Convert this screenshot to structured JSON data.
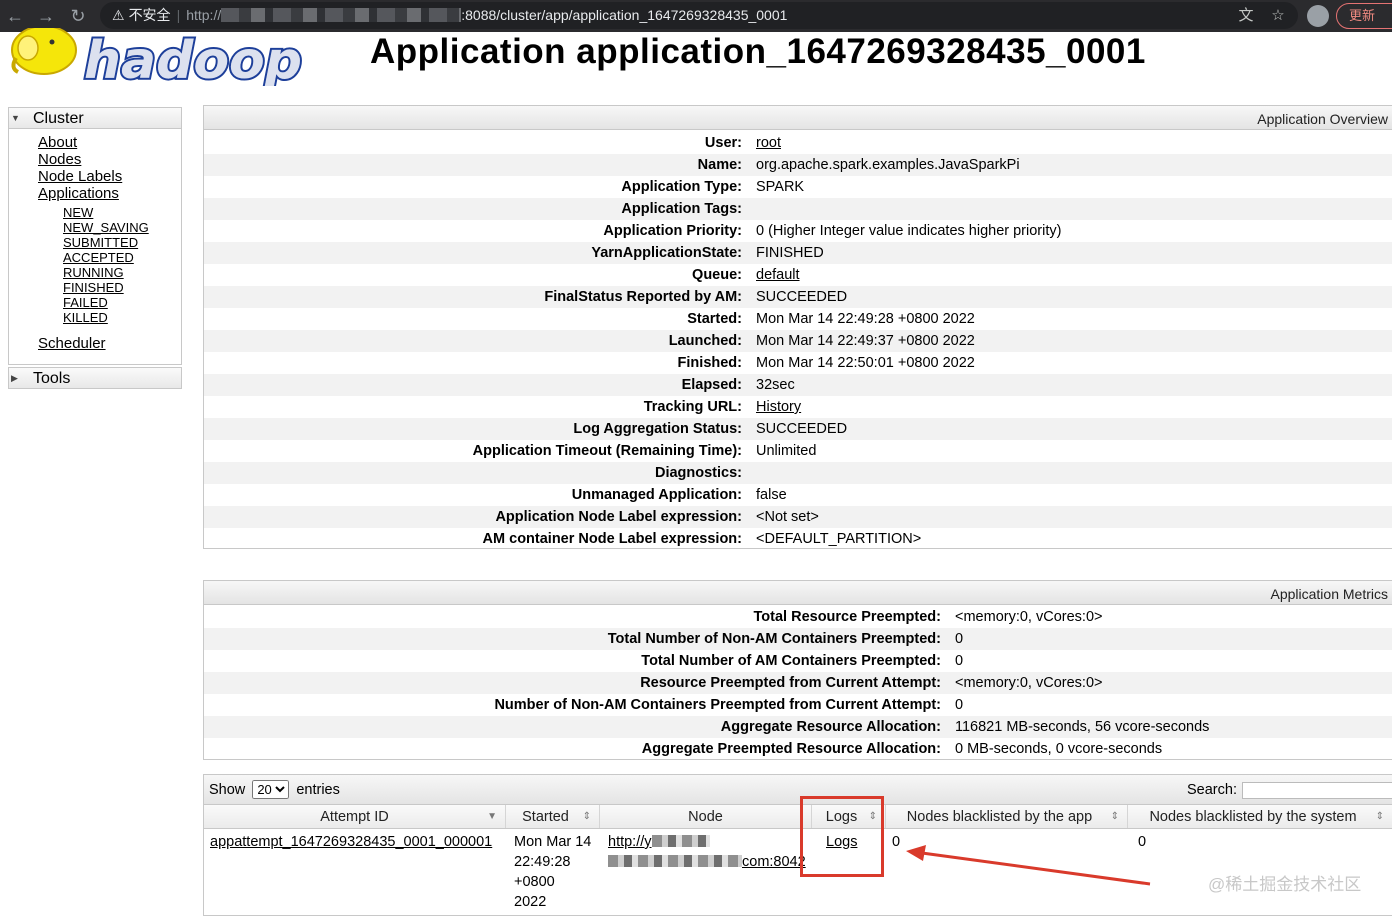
{
  "browser": {
    "security_label": "不安全",
    "url_scheme": "http://",
    "url_path": ":8088/cluster/app/application_1647269328435_0001",
    "update_label": "更新"
  },
  "page": {
    "title": "Application application_1647269328435_0001"
  },
  "sidebar": {
    "cluster_title": "Cluster",
    "links": [
      "About",
      "Nodes",
      "Node Labels",
      "Applications"
    ],
    "app_states": [
      "NEW",
      "NEW_SAVING",
      "SUBMITTED",
      "ACCEPTED",
      "RUNNING",
      "FINISHED",
      "FAILED",
      "KILLED"
    ],
    "scheduler": "Scheduler",
    "tools_title": "Tools"
  },
  "overview": {
    "title": "Application Overview",
    "rows": [
      {
        "k": "User:",
        "v": "root",
        "link": true
      },
      {
        "k": "Name:",
        "v": "org.apache.spark.examples.JavaSparkPi",
        "link": false
      },
      {
        "k": "Application Type:",
        "v": "SPARK",
        "link": false
      },
      {
        "k": "Application Tags:",
        "v": "",
        "link": false
      },
      {
        "k": "Application Priority:",
        "v": "0 (Higher Integer value indicates higher priority)",
        "link": false
      },
      {
        "k": "YarnApplicationState:",
        "v": "FINISHED",
        "link": false
      },
      {
        "k": "Queue:",
        "v": "default",
        "link": true
      },
      {
        "k": "FinalStatus Reported by AM:",
        "v": "SUCCEEDED",
        "link": false
      },
      {
        "k": "Started:",
        "v": "Mon Mar 14 22:49:28 +0800 2022",
        "link": false
      },
      {
        "k": "Launched:",
        "v": "Mon Mar 14 22:49:37 +0800 2022",
        "link": false
      },
      {
        "k": "Finished:",
        "v": "Mon Mar 14 22:50:01 +0800 2022",
        "link": false
      },
      {
        "k": "Elapsed:",
        "v": "32sec",
        "link": false
      },
      {
        "k": "Tracking URL:",
        "v": "History",
        "link": true
      },
      {
        "k": "Log Aggregation Status:",
        "v": "SUCCEEDED",
        "link": false
      },
      {
        "k": "Application Timeout (Remaining Time):",
        "v": "Unlimited",
        "link": false
      },
      {
        "k": "Diagnostics:",
        "v": "",
        "link": false
      },
      {
        "k": "Unmanaged Application:",
        "v": "false",
        "link": false
      },
      {
        "k": "Application Node Label expression:",
        "v": "<Not set>",
        "link": false
      },
      {
        "k": "AM container Node Label expression:",
        "v": "<DEFAULT_PARTITION>",
        "link": false
      }
    ]
  },
  "metrics": {
    "title": "Application Metrics",
    "rows": [
      {
        "k": "Total Resource Preempted:",
        "v": "<memory:0, vCores:0>"
      },
      {
        "k": "Total Number of Non-AM Containers Preempted:",
        "v": "0"
      },
      {
        "k": "Total Number of AM Containers Preempted:",
        "v": "0"
      },
      {
        "k": "Resource Preempted from Current Attempt:",
        "v": "<memory:0, vCores:0>"
      },
      {
        "k": "Number of Non-AM Containers Preempted from Current Attempt:",
        "v": "0"
      },
      {
        "k": "Aggregate Resource Allocation:",
        "v": "116821 MB-seconds, 56 vcore-seconds"
      },
      {
        "k": "Aggregate Preempted Resource Allocation:",
        "v": "0 MB-seconds, 0 vcore-seconds"
      }
    ]
  },
  "attempts": {
    "show_label": "Show",
    "entries_value": "20",
    "entries_label": "entries",
    "search_label": "Search:",
    "columns": [
      "Attempt ID",
      "Started",
      "Node",
      "Logs",
      "Nodes blacklisted by the app",
      "Nodes blacklisted by the system"
    ],
    "row": {
      "attempt_id": "appattempt_1647269328435_0001_000001",
      "started_lines": [
        "Mon Mar 14",
        "22:49:28",
        "+0800",
        "2022"
      ],
      "node_prefix": "http://y",
      "node_suffix": "com:8042",
      "logs": "Logs",
      "blacklisted_app": "0",
      "blacklisted_system": "0"
    }
  },
  "watermark": "@稀土掘金技术社区",
  "colors": {
    "annotation_red": "#d93a2b",
    "logo_yellow": "#f5e60a",
    "logo_blue": "#1d3f9a"
  }
}
